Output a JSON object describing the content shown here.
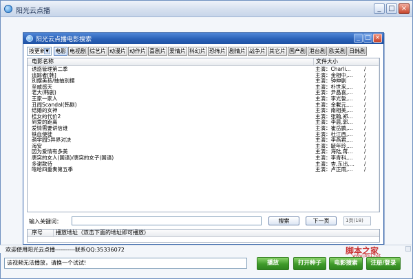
{
  "window": {
    "title": "阳光云点播",
    "minimize": "_",
    "maximize": "□",
    "close": "×"
  },
  "dialog": {
    "title": "阳光云点播电影搜索",
    "minimize": "_",
    "maximize": "□",
    "close": "×"
  },
  "categories": {
    "select_value": "按更新",
    "items": [
      "电影",
      "电视剧",
      "综艺片",
      "动漫片",
      "动作片",
      "喜剧片",
      "爱情片",
      "科幻片",
      "恐怖片",
      "剧情片",
      "战争片",
      "其它片",
      "国产剧",
      "港台剧",
      "欧美剧",
      "日韩剧"
    ]
  },
  "list": {
    "header_name": "电影名称",
    "header_size": "文件大小",
    "rows": [
      {
        "name": "诱惑管理第二季",
        "actor": "主演：Charli...",
        "size": "/"
      },
      {
        "name": "追踪者[韩]",
        "actor": "主演：金相中,...",
        "size": "/"
      },
      {
        "name": "別摆美孩/抽抽別摆",
        "actor": "主演：钟伸剧",
        "size": "/"
      },
      {
        "name": "至威感天",
        "actor": "主演：朴世来,...",
        "size": "/"
      },
      {
        "name": "老大(韩剧)",
        "actor": "主演：尹晶喜,...",
        "size": "/"
      },
      {
        "name": "王家一家人",
        "actor": "主演：李光誓,...",
        "size": "/"
      },
      {
        "name": "丑闻Scandal(韩剧)",
        "actor": "主演：金載元,...",
        "size": "/"
      },
      {
        "name": "结婚的女神",
        "actor": "主演：南相美,...",
        "size": "/"
      },
      {
        "name": "桂女的代价2",
        "actor": "主演：张翰,郑...",
        "size": "/"
      },
      {
        "name": "到爱的距离",
        "actor": "主演：李晨,郭...",
        "size": "/"
      },
      {
        "name": "爱情需要讲信谁",
        "actor": "主演：崔岳鹏,...",
        "size": "/"
      },
      {
        "name": "铁血使徒",
        "actor": "主演：杜江西,...",
        "size": "/"
      },
      {
        "name": "萌学园5异界对决",
        "actor": "主演：李燕君,...",
        "size": "/"
      },
      {
        "name": "海安",
        "actor": "主演：毓年玲,...",
        "size": "/"
      },
      {
        "name": "因为爱情有多美",
        "actor": "主演：海陆,蒋...",
        "size": "/"
      },
      {
        "name": "唐突的女人(国语)/唐突的女子(国语)",
        "actor": "主演：李青科,...",
        "size": "/"
      },
      {
        "name": "多谢款待",
        "actor": "主演：杏,东出,...",
        "size": "/"
      },
      {
        "name": "嘻哈四重奏第五季",
        "actor": "主演：卢正雨,...",
        "size": "/"
      }
    ]
  },
  "search": {
    "label": "输入关键词：",
    "input_value": "",
    "search_label": "搜索",
    "next_label": "下一页",
    "page_text": "1页(18)"
  },
  "links": {
    "header_no": "序号",
    "header_url": "播放地址（双击下面的地址即可播放）"
  },
  "status": {
    "text": "欢迎使用阳光云点播----------联系QQ:35336072"
  },
  "notice": {
    "value": "该视频无法播放，请换一个试试!"
  },
  "buttons": {
    "play": "播放",
    "seed": "打开种子",
    "movie_search": "电影搜索",
    "register": "注册/登录"
  },
  "watermark": {
    "main": "脚本之家",
    "sub": "www.jb51.net"
  }
}
